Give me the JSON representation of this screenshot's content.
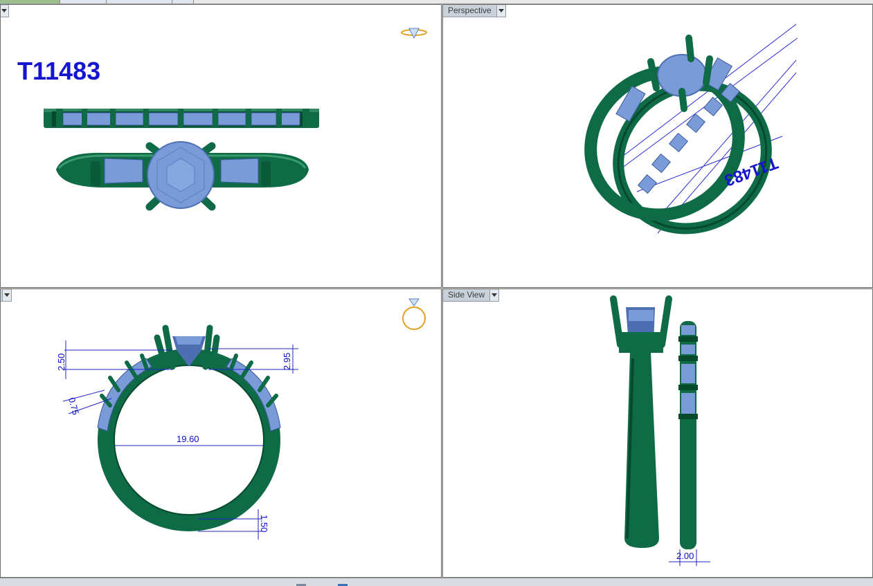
{
  "model_code": "T11483",
  "colors": {
    "metal": "#0e6b46",
    "metal_dark": "#064a2e",
    "gem": "#7a9bd8",
    "gem_dark": "#4d6fb2",
    "dimension": "#0a0ad0",
    "viewport_bg": "#ffffff",
    "label_bg": "#c9d2db"
  },
  "viewports": {
    "top_left": {
      "label": ""
    },
    "top_right": {
      "label": "Perspective"
    },
    "bottom_left": {
      "label": ""
    },
    "bottom_right": {
      "label": "Side View"
    }
  },
  "dimensions": {
    "band_height": "2.50",
    "head_height": "2.95",
    "inner_diameter": "19.60",
    "bottom_thickness": "1.50",
    "baguette_small": "0.75",
    "band_width": "2.00"
  },
  "icons": {
    "top_left_thumb": "ring-thumbnail-icon",
    "bottom_left_thumb": "ring-thumbnail-icon"
  }
}
